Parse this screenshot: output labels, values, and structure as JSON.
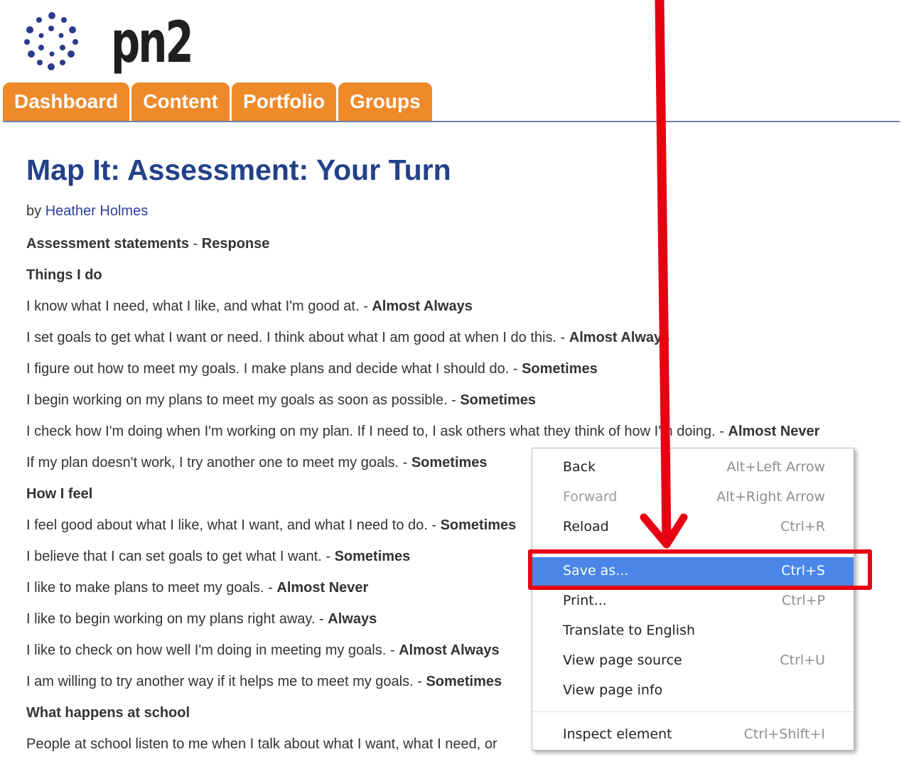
{
  "brand": {
    "name": "pn2",
    "dot_color": "#2a3a8c"
  },
  "nav": {
    "tabs": [
      {
        "label": "Dashboard"
      },
      {
        "label": "Content"
      },
      {
        "label": "Portfolio"
      },
      {
        "label": "Groups"
      }
    ],
    "tab_color": "#ee8a2a"
  },
  "page": {
    "title": "Map It: Assessment: Your Turn",
    "byline_prefix": "by",
    "author": "Heather Holmes",
    "header": {
      "statements": "Assessment statements",
      "separator": " - ",
      "response": "Response"
    },
    "sections": [
      {
        "heading": "Things I do",
        "items": [
          {
            "text": "I know what I need, what I like, and what I'm good at. - ",
            "response": "Almost Always"
          },
          {
            "text": "I set goals to get what I want or need. I think about what I am good at when I do this. - ",
            "response": "Almost Always"
          },
          {
            "text": "I figure out how to meet my goals. I make plans and decide what I should do. - ",
            "response": "Sometimes"
          },
          {
            "text": "I begin working on my plans to meet my goals as soon as possible. - ",
            "response": "Sometimes"
          },
          {
            "text": "I check how I'm doing when I'm working on my plan. If I need to, I ask others what they think of how I'm doing. - ",
            "response": "Almost Never"
          },
          {
            "text": "If my plan doesn't work, I try another one to meet my goals. - ",
            "response": "Sometimes"
          }
        ]
      },
      {
        "heading": "How I feel",
        "items": [
          {
            "text": "I feel good about what I like, what I want, and what I need to do. - ",
            "response": "Sometimes"
          },
          {
            "text": "I believe that I can set goals to get what I want. - ",
            "response": "Sometimes"
          },
          {
            "text": "I like to make plans to meet my goals. - ",
            "response": "Almost Never"
          },
          {
            "text": "I like to begin working on my plans right away. - ",
            "response": "Always"
          },
          {
            "text": "I like to check on how well I'm doing in meeting my goals. - ",
            "response": "Almost Always"
          },
          {
            "text": "I am willing to try another way if it helps me to meet my goals. - ",
            "response": "Sometimes"
          }
        ]
      },
      {
        "heading": "What happens at school",
        "items": [
          {
            "text": "People at school listen to me when I talk about what I want, what I need, or",
            "response": ""
          }
        ]
      }
    ]
  },
  "context_menu": {
    "items": [
      {
        "label": "Back",
        "shortcut": "Alt+Left Arrow"
      },
      {
        "label": "Forward",
        "shortcut": "Alt+Right Arrow"
      },
      {
        "label": "Reload",
        "shortcut": "Ctrl+R"
      },
      {
        "label": "Save as...",
        "shortcut": "Ctrl+S"
      },
      {
        "label": "Print...",
        "shortcut": "Ctrl+P"
      },
      {
        "label": "Translate to English",
        "shortcut": ""
      },
      {
        "label": "View page source",
        "shortcut": "Ctrl+U"
      },
      {
        "label": "View page info",
        "shortcut": ""
      },
      {
        "label": "Inspect element",
        "shortcut": "Ctrl+Shift+I"
      }
    ],
    "selected_color": "#4a86e8"
  },
  "annotation": {
    "color": "#e60012"
  }
}
